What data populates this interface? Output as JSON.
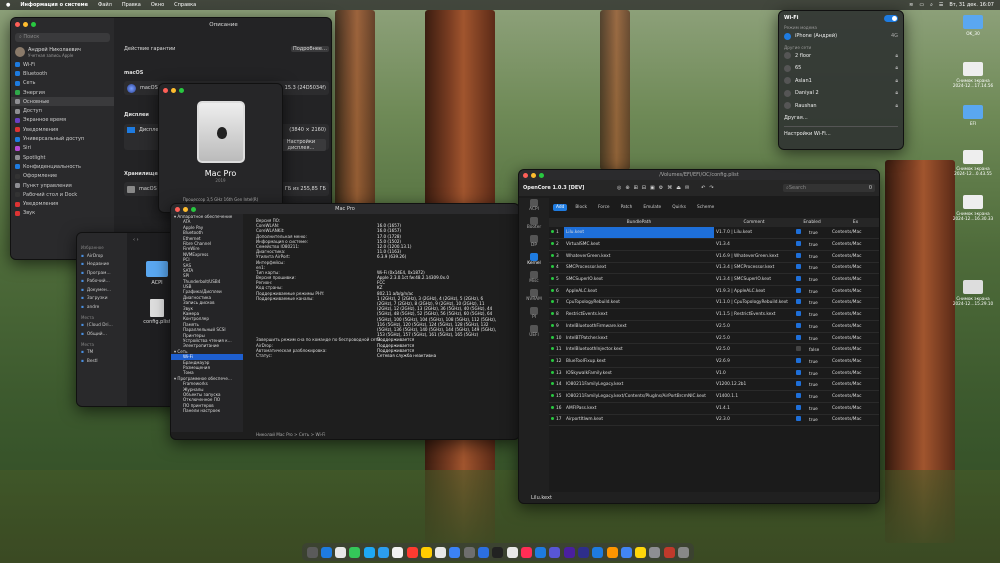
{
  "menubar": {
    "apple": "",
    "app": "Информация о системе",
    "items": [
      "Файл",
      "Правка",
      "Окно",
      "Справка"
    ],
    "clock": "Вт, 31 дек. 16:07"
  },
  "settings": {
    "search_placeholder": "Поиск",
    "user_name": "Андрей Николаевич",
    "user_sub": "Учетная запись Apple",
    "title": "Описание",
    "items": [
      {
        "label": "Wi-Fi",
        "color": "#1e7be0"
      },
      {
        "label": "Bluetooth",
        "color": "#1e7be0"
      },
      {
        "label": "Сеть",
        "color": "#1e7be0"
      },
      {
        "label": "Энергия",
        "color": "#2fa84a"
      },
      {
        "label": "Основные",
        "color": "#8e8e93"
      },
      {
        "label": "Доступ",
        "color": "#8e8e93"
      },
      {
        "label": "Экранное время",
        "color": "#6a40c4"
      },
      {
        "label": "Уведомления",
        "color": "#d33"
      },
      {
        "label": "Универсальный доступ",
        "color": "#1e7be0"
      },
      {
        "label": "Siri",
        "color": "#b84bd6"
      },
      {
        "label": "Spotlight",
        "color": "#8e8e93"
      },
      {
        "label": "Конфиденциальность",
        "color": "#1e7be0"
      },
      {
        "label": "Оформление",
        "color": "#333"
      },
      {
        "label": "Пункт управления",
        "color": "#8e8e93"
      },
      {
        "label": "Рабочий стол и Dock",
        "color": "#333"
      },
      {
        "label": "Уведомления",
        "color": "#d33"
      },
      {
        "label": "Звук",
        "color": "#d33"
      }
    ],
    "warranty_label": "Действие гарантии",
    "details_button": "Подробнее…",
    "macos_heading": "macOS",
    "macos_name": "macOS S",
    "macos_version": "15.3 (24D5034f)",
    "displays_heading": "Дисплеи",
    "display_name": "Дисплей",
    "display_res": "(3840 × 2160)",
    "display_button": "Настройки дисплея…",
    "storage_heading": "Хранилище",
    "storage_name": "macOS",
    "storage_val": "ГБ из 255,85 ГБ"
  },
  "macpro_card": {
    "title": "Mac Pro",
    "year": "2019",
    "processor": "Процессор  3,5 GHz 16th Gen Intel(R)"
  },
  "finder": {
    "favorites_heading": "Избранное",
    "items": [
      "AirDrop",
      "Недавние",
      "Програм…",
      "Рабочий…",
      "Докумен…",
      "Загрузки",
      "andre"
    ],
    "locations_heading": "Места",
    "loc": [
      "(Cloud Dri…",
      "Общий…"
    ],
    "tags_heading": "Места",
    "tags": [
      "TM",
      "Bestl"
    ],
    "files": [
      {
        "name": "ACPI"
      },
      {
        "name": "config.plist"
      }
    ]
  },
  "sysinfo": {
    "title": "Mac Pro",
    "tree": [
      "Аппаратное обеспечение",
      "ATA",
      "Apple Pay",
      "Bluetooth",
      "Ethernet",
      "Fibre Channel",
      "FireWire",
      "NVMExpress",
      "PCI",
      "SAS",
      "SATA",
      "SPI",
      "Thunderbolt/USB4",
      "USB",
      "Графика/Дисплеи",
      "Диагностика",
      "Запись дисков",
      "Звук",
      "Камера",
      "Контроллер",
      "Память",
      "Параллельный SCSI",
      "Принтеры",
      "Устройства чтения к…",
      "Электропитание",
      "Сеть",
      "Wi-Fi",
      "Брандмауэр",
      "Размещения",
      "Тома",
      "Программное обеспече…",
      "Frameworks",
      "Журналы",
      "Объекты запуска",
      "Отключенное ПО",
      "ПО принтеров",
      "Панели настроек"
    ],
    "selected": "Wi-Fi",
    "breadcrumb": "Николай Mac Pro > Сеть > Wi-Fi",
    "props": [
      [
        "Версия ПО:",
        ""
      ],
      [
        "CoreWLAN:",
        "16.0 (1657)"
      ],
      [
        "CoreWLANKit:",
        "16.0 (1657)"
      ],
      [
        "Дополнительная меню:",
        "17.0 (1728)"
      ],
      [
        "Информация о системе:",
        "15.0 (1502)"
      ],
      [
        "Семейство IO80211:",
        "12.0 (1200.13.1)"
      ],
      [
        "Диагностика:",
        "11.0 (1163)"
      ],
      [
        "Утилита AirPort:",
        "6.3.9 (639.26)"
      ],
      [
        "Интерфейсы:",
        ""
      ],
      [
        "en1:",
        ""
      ],
      [
        "Тип карты:",
        "Wi-Fi (0x14E4, 0x1872)"
      ],
      [
        "Версия прошивки:",
        "Apple 2.3.0.1ct fw:48.2.14309.0x.0"
      ],
      [
        "Регион:",
        "FCC"
      ],
      [
        "Код страны:",
        "KZ"
      ],
      [
        "Поддерживаемые режимы PHY:",
        "802.11 a/b/g/n/ac"
      ],
      [
        "Поддерживаемые каналы:",
        "1 (2GHz), 2 (2GHz), 3 (2GHz), 4 (2GHz), 5 (2GHz), 6"
      ],
      [
        "",
        "(2GHz), 7 (2GHz), 8 (2GHz), 9 (2GHz), 10 (2GHz), 11"
      ],
      [
        "",
        "(2GHz), 12 (2GHz), 13 (2GHz), 36 (5GHz), 40 (5GHz), 44"
      ],
      [
        "",
        "(5GHz), 48 (5GHz), 52 (5GHz), 56 (5GHz), 60 (5GHz), 64"
      ],
      [
        "",
        "(5GHz), 100 (5GHz), 104 (5GHz), 108 (5GHz), 112 (5GHz),"
      ],
      [
        "",
        "116 (5GHz), 120 (5GHz), 124 (5GHz), 128 (5GHz), 132"
      ],
      [
        "",
        "(5GHz), 136 (5GHz), 140 (5GHz), 144 (5GHz), 149 (5GHz),"
      ],
      [
        "",
        "153 (5GHz), 157 (5GHz), 161 (5GHz), 165 (5GHz)"
      ],
      [
        "Завершить режим сна по команде по беспроводной сети:",
        "Поддерживается"
      ],
      [
        "AirDrop:",
        "Поддерживается"
      ],
      [
        "Автоматическая разблокировка:",
        "Поддерживается"
      ],
      [
        "Статус:",
        "Сетевая служба неактивна"
      ]
    ]
  },
  "opencore": {
    "title": "OpenCore 1.0.3 [DEV]",
    "path": "/Volumes/EFI/EFI/OC/config.plist",
    "search_placeholder": "Search",
    "search_count": "0",
    "nav": [
      "ACPI",
      "Booter",
      "DP",
      "Kernel",
      "Misc",
      "NVRAM",
      "PI",
      "UEFI"
    ],
    "active_nav": "Kernel",
    "tabs": [
      "Add",
      "Block",
      "Force",
      "Patch",
      "Emulate",
      "Quirks",
      "Scheme"
    ],
    "active_tab": "Add",
    "columns": [
      "BundlePath",
      "Comment",
      "Enabled",
      "Ex"
    ],
    "rows": [
      [
        "1",
        "Lilu.kext",
        "V1.7.0 | Lilu.kext",
        "true",
        "Contents/Mac"
      ],
      [
        "2",
        "VirtualSMC.kext",
        "V1.3.4",
        "true",
        "Contents/Mac"
      ],
      [
        "3",
        "WhateverGreen.kext",
        "V1.6.9 | WhateverGreen.kext",
        "true",
        "Contents/Mac"
      ],
      [
        "4",
        "SMCProcessor.kext",
        "V1.3.4 | SMCProcessor.kext",
        "true",
        "Contents/Mac"
      ],
      [
        "5",
        "SMCSuperIO.kext",
        "V1.3.4 | SMCSuperIO.kext",
        "true",
        "Contents/Mac"
      ],
      [
        "6",
        "AppleALC.kext",
        "V1.9.3 | AppleALC.kext",
        "true",
        "Contents/Mac"
      ],
      [
        "7",
        "CpuTopologyRebuild.kext",
        "V1.1.0 | CpuTopologyRebuild.kext",
        "true",
        "Contents/Mac"
      ],
      [
        "8",
        "RestrictEvents.kext",
        "V1.1.5 | RestrictEvents.kext",
        "true",
        "Contents/Mac"
      ],
      [
        "9",
        "IntelBluetoothFirmware.kext",
        "V2.5.0",
        "true",
        "Contents/Mac"
      ],
      [
        "10",
        "IntelBTPatcher.kext",
        "V2.5.0",
        "true",
        "Contents/Mac"
      ],
      [
        "11",
        "IntelBluetoothInjector.kext",
        "V2.5.0",
        "false",
        "Contents/Mac"
      ],
      [
        "12",
        "BlueToolFixup.kext",
        "V2.6.9",
        "true",
        "Contents/Mac"
      ],
      [
        "13",
        "IOSkywalkFamily.kext",
        "V1.0",
        "true",
        "Contents/Mac"
      ],
      [
        "14",
        "IO80211FamilyLegacy.kext",
        "V1200.12.2b1",
        "true",
        "Contents/Mac"
      ],
      [
        "15",
        "IO80211FamilyLegacy.kext/Contents/PlugIns/AirPortBrcmNIC.kext",
        "V1400.1.1",
        "true",
        "Contents/Mac"
      ],
      [
        "16",
        "AMFIPass.kext",
        "V1.4.1",
        "true",
        "Contents/Mac"
      ],
      [
        "17",
        "AirportItlwm.kext",
        "V2.3.0",
        "true",
        "Contents/Mac"
      ]
    ],
    "status": "Lilu.kext"
  },
  "wifi_menu": {
    "title": "Wi-Fi",
    "hotspot_heading": "Режим модема",
    "hotspot": "iPhone (Андрей)",
    "hotspot_signal": "4G",
    "other_heading": "Другие сети",
    "networks": [
      "2 floor",
      "65",
      "Aslan1",
      "Daniyal 2",
      "Raushan"
    ],
    "other_item": "Другая…",
    "settings_item": "Настройки Wi-Fi…"
  },
  "desktop": [
    {
      "label": "OK_30"
    },
    {
      "label": "Снимок экрана 2024-12…17.14.56"
    },
    {
      "label": "EFI"
    },
    {
      "label": "Снимок экрана 2024-12…0.43.55"
    },
    {
      "label": "Снимок экрана 2024-12…16.30.33"
    },
    {
      "label": "Снимок экрана 2024-12…15.29.10"
    }
  ],
  "dock_colors": [
    "#5a5a5a",
    "#1e7be0",
    "#e8e8e8",
    "#34c759",
    "#1ea8f5",
    "#2c9ef0",
    "#f2f2f2",
    "#ff3b30",
    "#ffcc00",
    "#e8e8e8",
    "#3b82f6",
    "#6e6e6e",
    "#2c6fe0",
    "#222",
    "#e8e8e8",
    "#ff2d55",
    "#1e7be0",
    "#5856d6",
    "#4a1f9e",
    "#2e2e8a",
    "#1e7be0",
    "#ff9500",
    "#4285f4",
    "#ffd60a",
    "#8e8e93",
    "#c0392b",
    "#888"
  ]
}
